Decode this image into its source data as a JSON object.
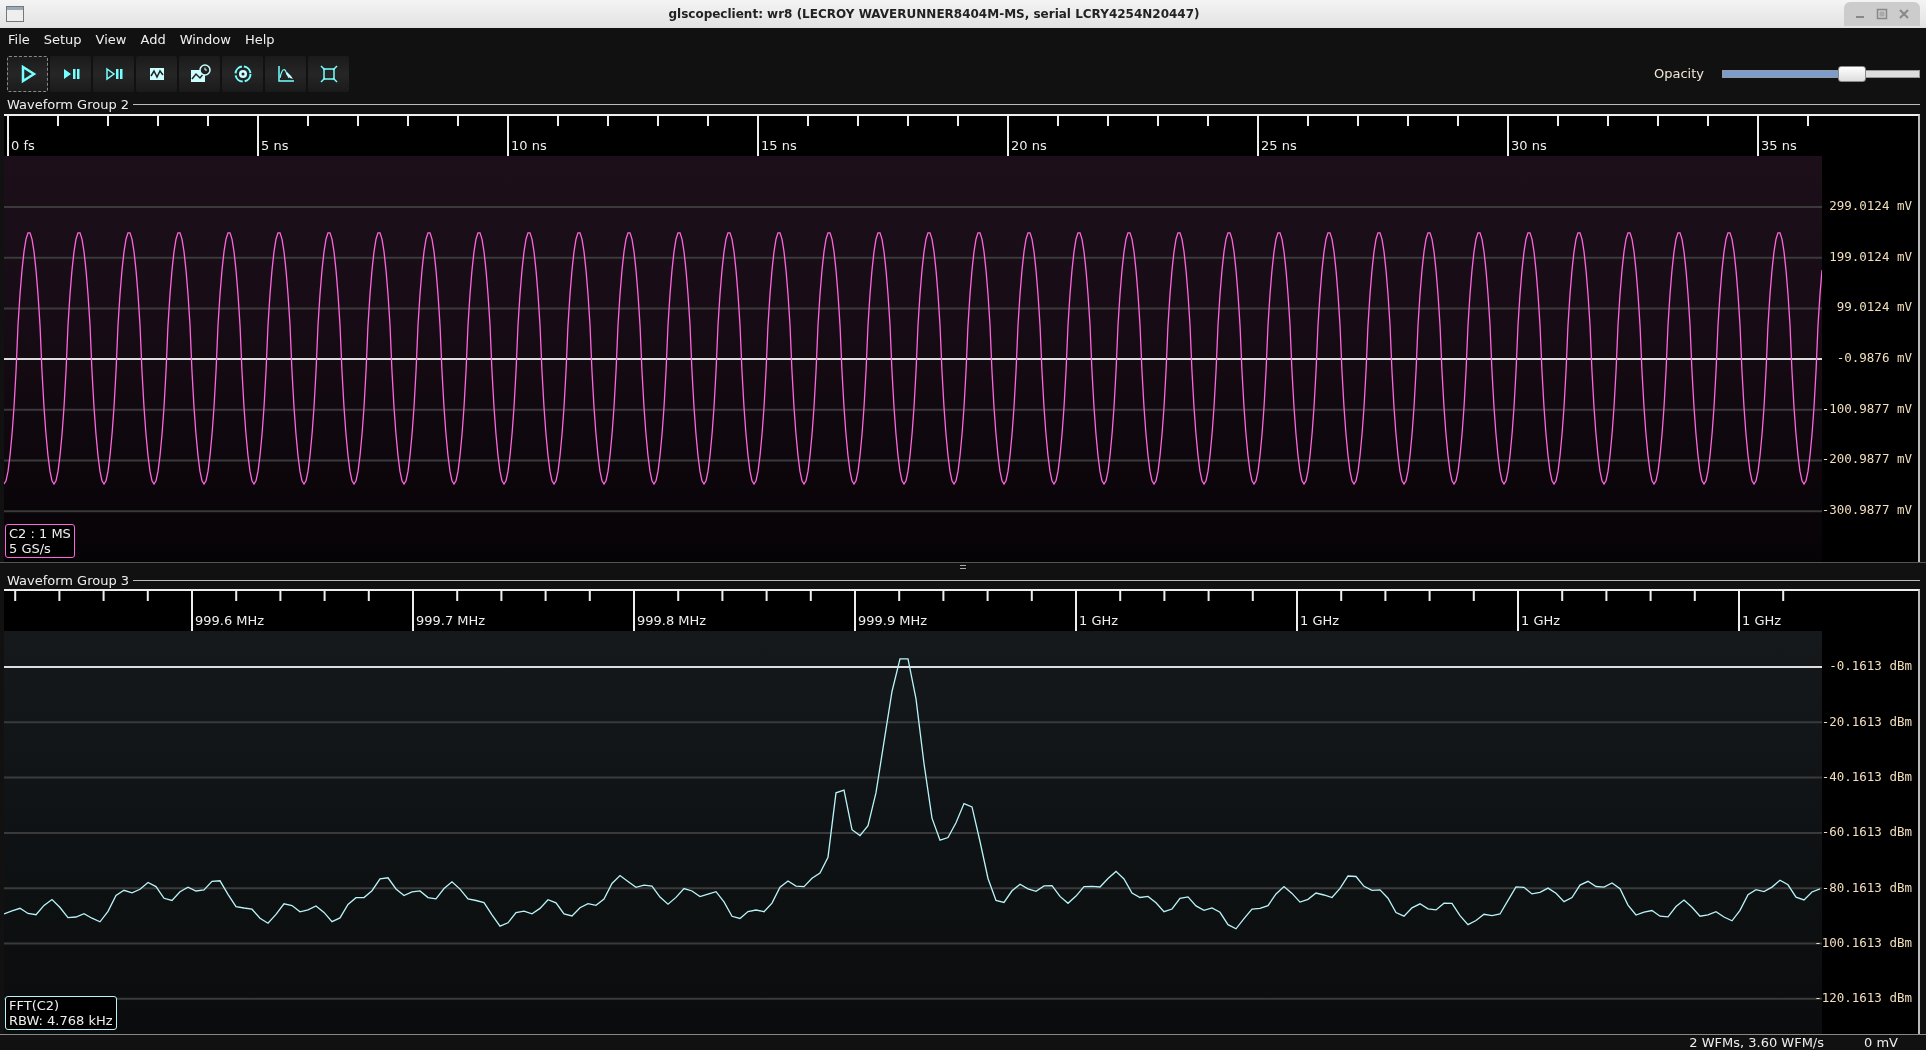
{
  "window": {
    "title": "glscopeclient: wr8 (LECROY WAVERUNNER8404M-MS, serial LCRY4254N20447)"
  },
  "menu": [
    "File",
    "Setup",
    "View",
    "Add",
    "Window",
    "Help"
  ],
  "toolbar": [
    {
      "kind": "start",
      "focused": true
    },
    {
      "kind": "single",
      "focused": false
    },
    {
      "kind": "force",
      "focused": false
    },
    {
      "kind": "waveform",
      "focused": false
    },
    {
      "kind": "history",
      "focused": false
    },
    {
      "kind": "refresh",
      "focused": false
    },
    {
      "kind": "graph",
      "focused": false
    },
    {
      "kind": "fullscreen",
      "focused": false
    }
  ],
  "opacity": {
    "label": "Opacity",
    "level": 0.66
  },
  "groups": [
    {
      "title": "Waveform Group 2",
      "kind": "time",
      "color": "#ff66dd",
      "ruler": [
        "0 fs",
        "5 ns",
        "10 ns",
        "15 ns",
        "20 ns",
        "25 ns",
        "30 ns",
        "35 ns"
      ],
      "axis": [
        "299.0124 mV",
        "199.0124 mV",
        "99.0124 mV",
        "-0.9876 mV",
        "-100.9877 mV",
        "-200.9877 mV",
        "-300.9877 mV"
      ],
      "channel_label": [
        "C2 : 1 MS",
        "5 GS/s"
      ]
    },
    {
      "title": "Waveform Group 3",
      "kind": "spectrum",
      "color": "#b8f4f8",
      "ruler": [
        "999.6 MHz",
        "999.7 MHz",
        "999.8 MHz",
        "999.9 MHz",
        "1 GHz",
        "1 GHz",
        "1 GHz",
        "1 GHz"
      ],
      "axis": [
        "-0.1613 dBm",
        "-20.1613 dBm",
        "-40.1613 dBm",
        "-60.1613 dBm",
        "-80.1613 dBm",
        "-100.1613 dBm",
        "-120.1613 dBm"
      ],
      "channel_label": [
        "FFT(C2)",
        "RBW: 4.768 kHz"
      ]
    }
  ],
  "status_bar": [
    "2 WFMs, 3.60 WFM/s",
    "0 mV"
  ]
}
